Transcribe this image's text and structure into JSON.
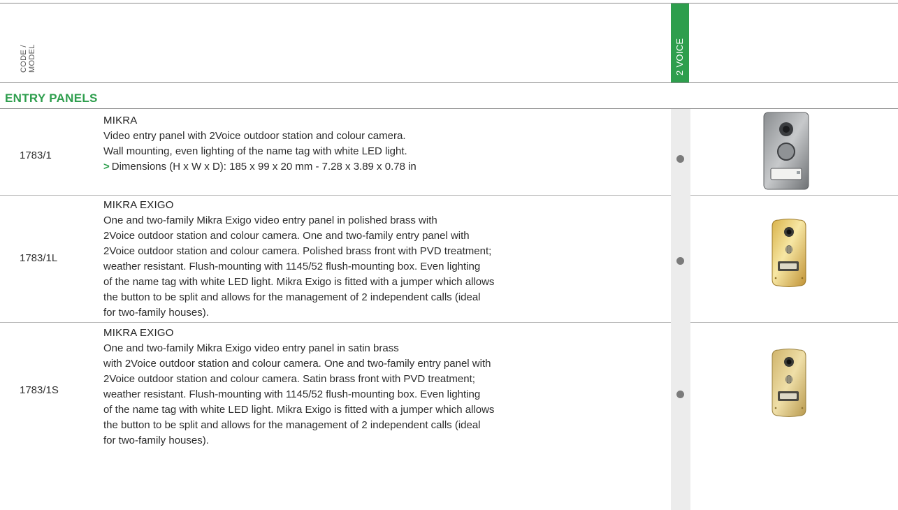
{
  "header": {
    "code_model_line1": "CODE /",
    "code_model_line2": "MODEL",
    "column_voice": "2 VOICE"
  },
  "section": {
    "title": "ENTRY PANELS"
  },
  "rows": [
    {
      "code": "1783/1",
      "name": "MIKRA",
      "lines": [
        "Video entry panel with 2Voice outdoor station and colour camera.",
        "Wall mounting, even lighting of the name tag with white LED light."
      ],
      "dimensions": "Dimensions (H x W x D): 185 x 99 x 20 mm - 7.28 x 3.89 x 0.78 in",
      "available": true
    },
    {
      "code": "1783/1L",
      "name": "MIKRA EXIGO",
      "lines": [
        "One and two-family Mikra Exigo video entry panel in polished brass with",
        "2Voice outdoor station and colour camera. One and two-family entry panel with",
        "2Voice outdoor station and colour camera. Polished brass front with PVD treatment;",
        "weather resistant. Flush-mounting with 1145/52 flush-mounting box. Even lighting",
        "of the name tag with white LED light. Mikra Exigo is fitted with a jumper which allows",
        "the button to be split and allows for the management of 2 independent calls (ideal",
        "for two-family houses)."
      ],
      "available": true
    },
    {
      "code": "1783/1S",
      "name": "MIKRA EXIGO",
      "lines": [
        "One and two-family Mikra Exigo video entry panel in satin brass",
        "with 2Voice outdoor station and colour camera. One and two-family entry panel with",
        "2Voice outdoor station and colour camera. Satin brass front with PVD treatment;",
        "weather resistant. Flush-mounting with 1145/52 flush-mounting box. Even lighting",
        "of the name tag with white LED light. Mikra Exigo is fitted with a jumper which allows",
        "the button to be split and allows for the management of 2 independent calls (ideal",
        "for two-family houses)."
      ],
      "available": true
    }
  ],
  "colors": {
    "accent_green": "#2e9e4d",
    "column_gray": "#ececec",
    "dot": "#7b7b7b"
  }
}
